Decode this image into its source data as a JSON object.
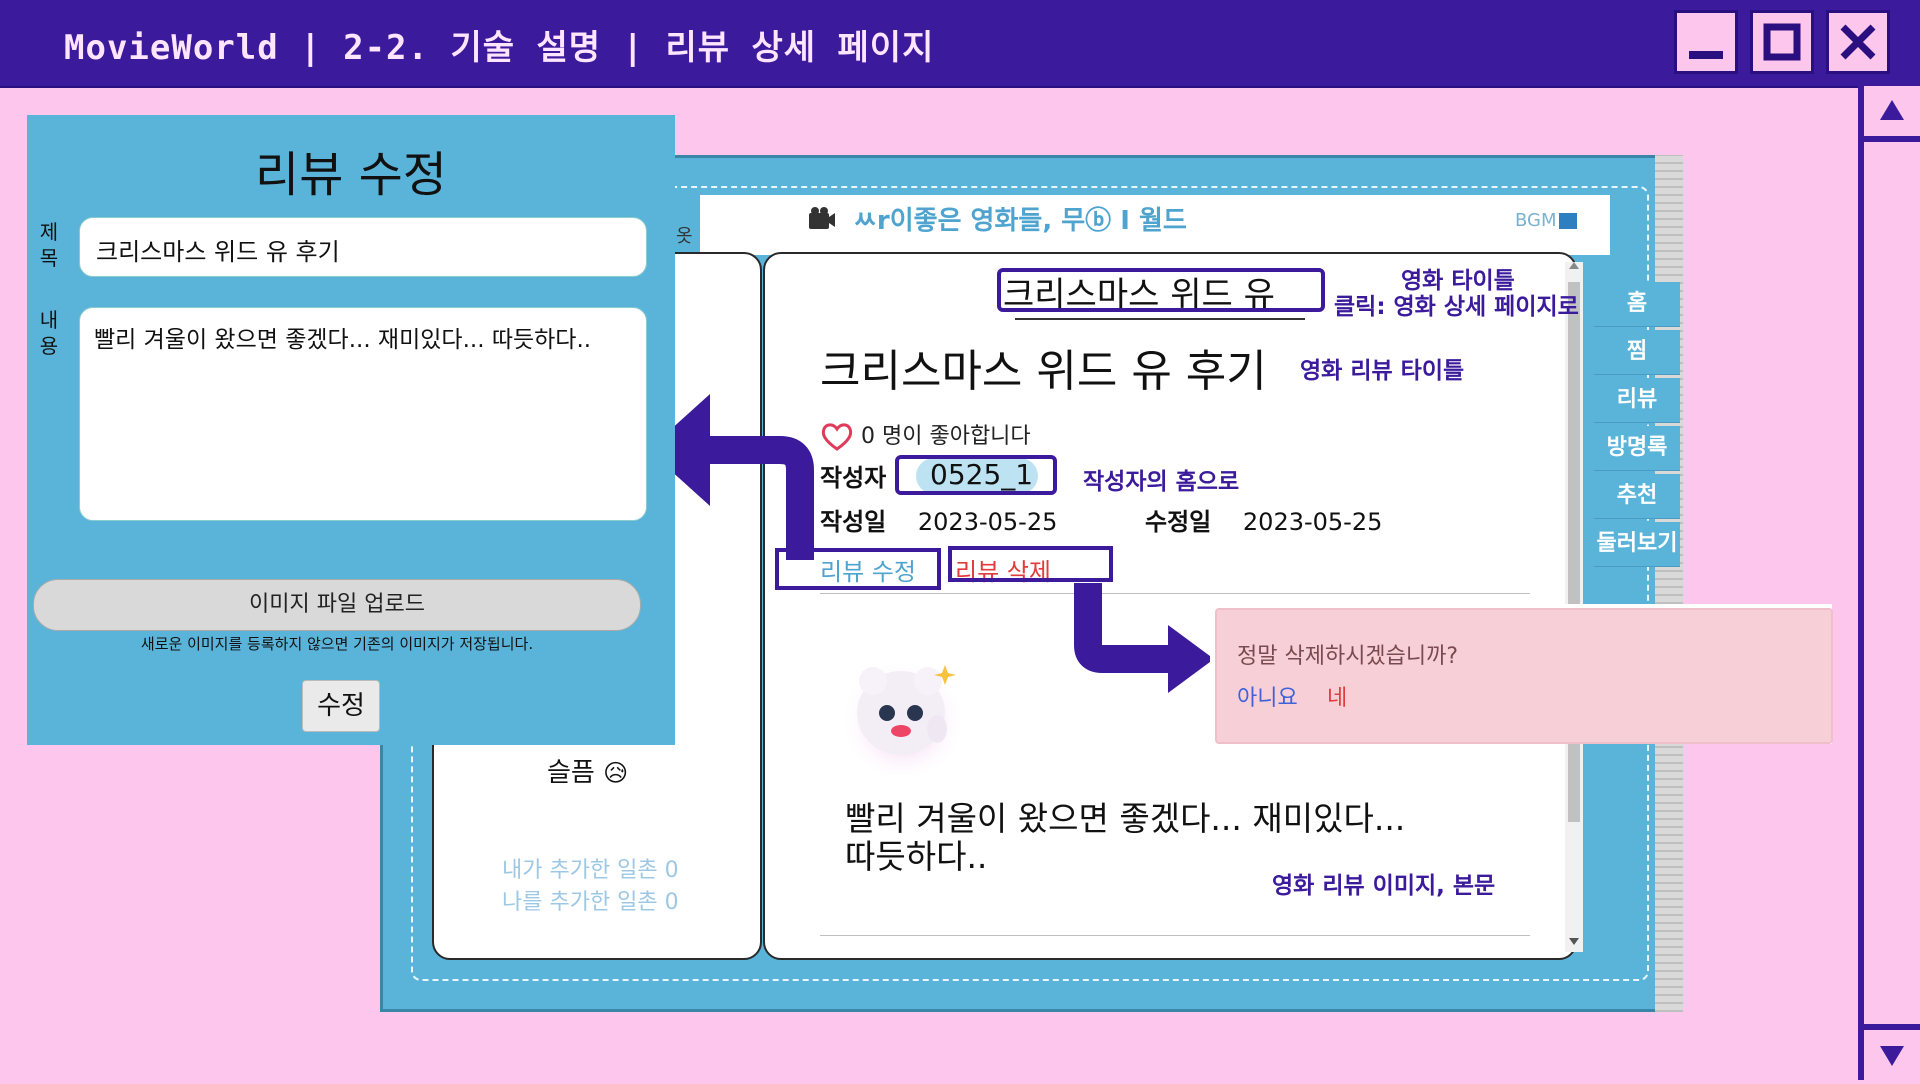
{
  "window": {
    "title": "MovieWorld | 2-2. 기술 설명 | 리뷰 상세 페이지",
    "minimize_icon": "minimize-icon",
    "maximize_icon": "maximize-icon",
    "close_icon": "close-icon"
  },
  "header": {
    "site_title": "ㅆr이좋은 영화들, 무ⓑ I 월드",
    "bgm": "BGM"
  },
  "side_nav": [
    "홈",
    "찜",
    "리뷰",
    "방명록",
    "추천",
    "둘러보기"
  ],
  "left_page": {
    "mood_label": "슬픔",
    "mood_emoji": "😥",
    "friends_added": "내가 추가한 일촌 0",
    "friends_added_me": "나를 추가한 일촌 0",
    "partial_text": "옷"
  },
  "review": {
    "movie_title": "크리스마스 위드 유",
    "title": "크리스마스 위드 유 후기",
    "likes": "0 명이 좋아합니다",
    "author_label": "작성자",
    "author": "0525_1",
    "created_label": "작성일",
    "created": "2023-05-25",
    "updated_label": "수정일",
    "updated": "2023-05-25",
    "edit_button": "리뷰 수정",
    "delete_button": "리뷰 삭제",
    "body_line1": "빨리 겨울이 왔으면 좋겠다... 재미있다...",
    "body_line2": "따듯하다.."
  },
  "annotations": {
    "movie_title_1": "영화 타이틀",
    "movie_title_2": "클릭: 영화 상세 페이지로",
    "review_title": "영화 리뷰 타이틀",
    "author_home": "작성자의 홈으로",
    "review_body": "영화 리뷰 이미지, 본문"
  },
  "edit_modal": {
    "title": "리뷰 수정",
    "title_label_1": "제",
    "title_label_2": "목",
    "content_label_1": "내",
    "content_label_2": "용",
    "title_value": "크리스마스 위드 유 후기",
    "content_value": "빨리 겨울이 왔으면 좋겠다... 재미있다... 따듯하다..",
    "upload_button": "이미지 파일 업로드",
    "upload_note": "새로운 이미지를 등록하지 않으면 기존의 이미지가 저장됩니다.",
    "submit_button": "수정"
  },
  "delete_confirm": {
    "question": "정말 삭제하시겠습니까?",
    "no": "아니요",
    "yes": "네"
  },
  "colors": {
    "frame": "#3b1a9c",
    "background": "#fdc6ec",
    "book": "#5ab4d9",
    "delete": "#e23b3b"
  }
}
